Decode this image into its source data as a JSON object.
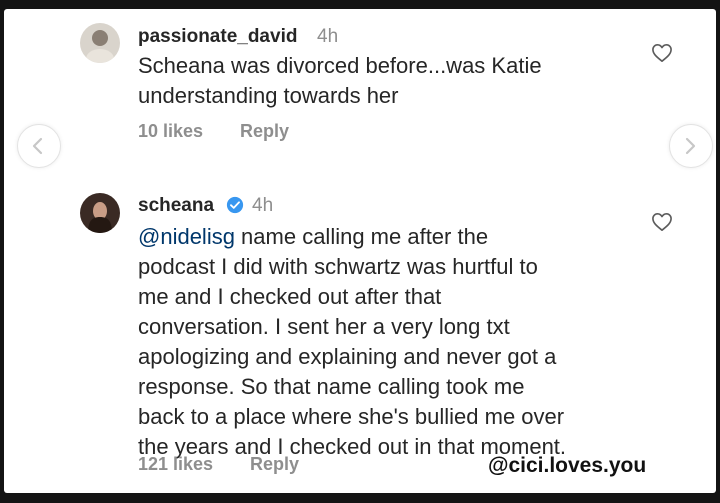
{
  "comments": [
    {
      "username": "passionate_david",
      "time": "4h",
      "text_lines": [
        "Scheana was divorced before...was Katie",
        "understanding towards her"
      ],
      "likes": "10 likes",
      "reply": "Reply",
      "avatar_icon": "person-avatar-icon",
      "like_icon": "heart-outline-icon"
    },
    {
      "username": "scheana",
      "verified": true,
      "time": "4h",
      "mention": "@nidelisg",
      "text_lines": [
        " name calling me after the",
        "podcast I did with schwartz was hurtful to",
        "me and I checked out after that",
        "conversation. I sent her a very long txt",
        "apologizing and explaining and never got a",
        "response. So that name calling took me",
        "back to a place where she's bullied me over",
        "the years and I checked out in that moment."
      ],
      "likes": "121 likes",
      "reply": "Reply",
      "avatar_icon": "person-avatar-icon",
      "like_icon": "heart-outline-icon"
    }
  ],
  "nav": {
    "prev_icon": "chevron-left-icon",
    "next_icon": "chevron-right-icon"
  },
  "watermark": "@cici.loves.you",
  "colors": {
    "text": "#262626",
    "muted": "#8e8e8e",
    "mention": "#00376b",
    "verified": "#3897f0",
    "background": "#ffffff"
  }
}
